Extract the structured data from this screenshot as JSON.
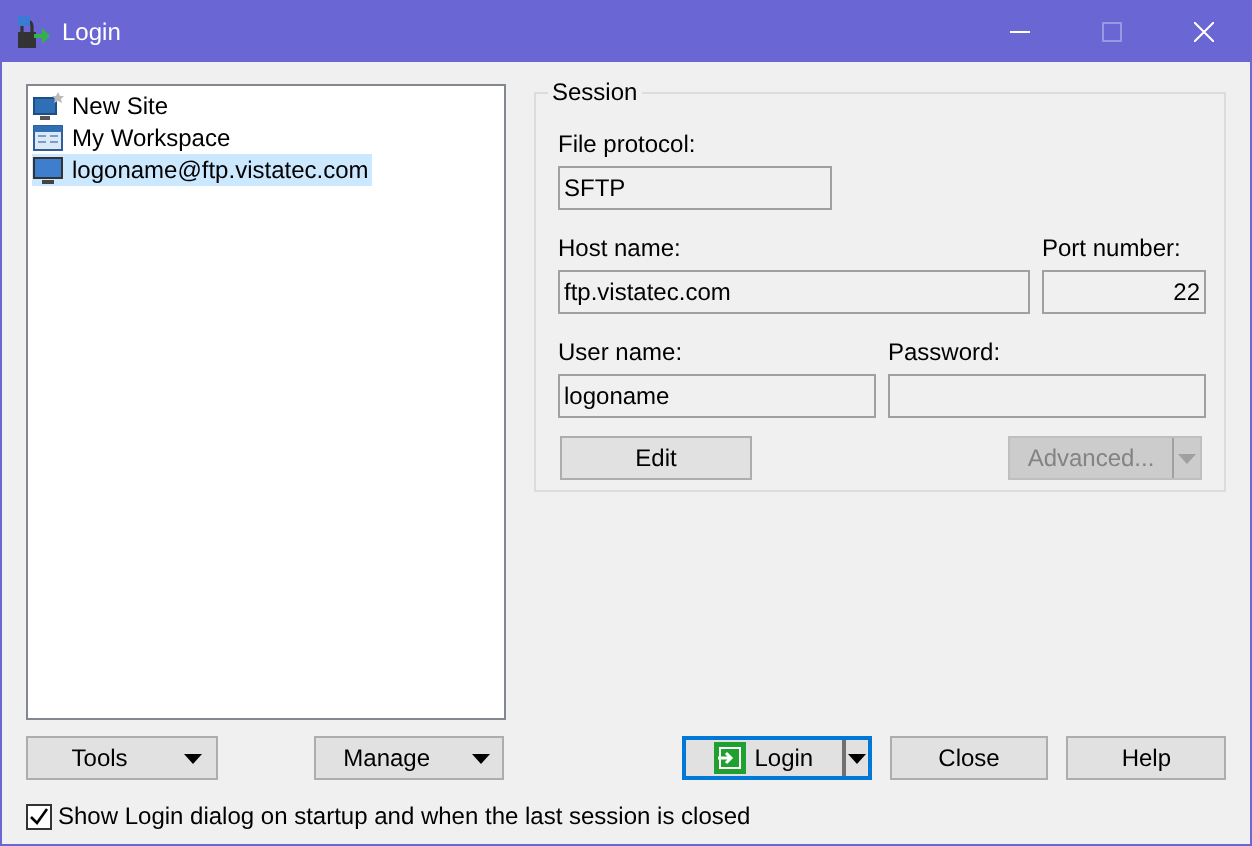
{
  "window": {
    "title": "Login"
  },
  "sites": [
    {
      "label": "New Site",
      "kind": "new-site",
      "selected": false
    },
    {
      "label": "My Workspace",
      "kind": "workspace",
      "selected": false
    },
    {
      "label": "logoname@ftp.vistatec.com",
      "kind": "site",
      "selected": true
    }
  ],
  "session": {
    "title": "Session",
    "file_protocol": {
      "label": "File protocol:",
      "value": "SFTP"
    },
    "host_name": {
      "label": "Host name:",
      "value": "ftp.vistatec.com"
    },
    "port_number": {
      "label": "Port number:",
      "value": "22"
    },
    "user_name": {
      "label": "User name:",
      "value": "logoname"
    },
    "password": {
      "label": "Password:"
    },
    "edit_button": {
      "label": "Edit",
      "disabled": false
    },
    "advanced_button": {
      "label": "Advanced...",
      "disabled": true
    }
  },
  "bottom_buttons": [
    {
      "label": "Tools",
      "kind": "menu"
    },
    {
      "label": "Manage",
      "kind": "menu"
    },
    {
      "label": "Login",
      "kind": "split-default"
    },
    {
      "label": "Close",
      "kind": "plain"
    },
    {
      "label": "Help",
      "kind": "plain"
    }
  ],
  "show_on_startup": {
    "label": "Show Login dialog on startup and when the last session is closed",
    "checked": true
  }
}
